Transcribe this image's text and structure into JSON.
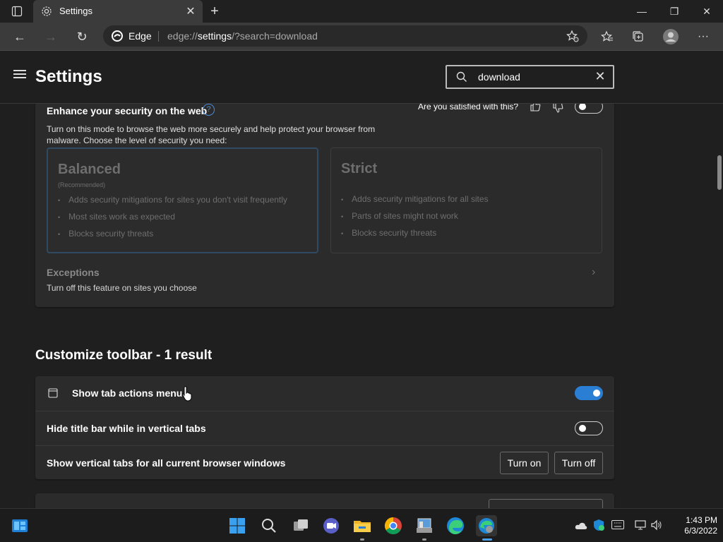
{
  "browser": {
    "tab_title": "Settings",
    "edge_label": "Edge",
    "url_prefix": "edge://",
    "url_main": "settings",
    "url_suffix": "/?search=download"
  },
  "settings": {
    "page_title": "Settings",
    "search_value": "download"
  },
  "security": {
    "title": "Enhance your security on the web",
    "feedback_question": "Are you satisfied with this?",
    "toggle_on": false,
    "description_line1": "Turn on this mode to browse the web more securely and help protect your browser from",
    "description_line2": "malware. Choose the level of security you need:",
    "balanced": {
      "title": "Balanced",
      "subtitle": "(Recommended)",
      "items": [
        "Adds security mitigations for sites you don't visit frequently",
        "Most sites work as expected",
        "Blocks security threats"
      ]
    },
    "strict": {
      "title": "Strict",
      "items": [
        "Adds security mitigations for all sites",
        "Parts of sites might not work",
        "Blocks security threats"
      ]
    },
    "exceptions_title": "Exceptions",
    "exceptions_desc": "Turn off this feature on sites you choose"
  },
  "toolbar_section": {
    "heading": "Customize toolbar - 1 result",
    "rows": [
      {
        "label": "Show tab actions menu",
        "toggle_on": true
      },
      {
        "label": "Hide title bar while in vertical tabs",
        "toggle_on": false
      },
      {
        "label": "Show vertical tabs for all current browser windows"
      }
    ],
    "turn_on_label": "Turn on",
    "turn_off_label": "Turn off"
  },
  "taskbar": {
    "time": "1:43 PM",
    "date": "6/3/2022"
  },
  "colors": {
    "accent": "#2a7fd4",
    "background": "#1f1f1f",
    "card": "#2b2b2b"
  }
}
